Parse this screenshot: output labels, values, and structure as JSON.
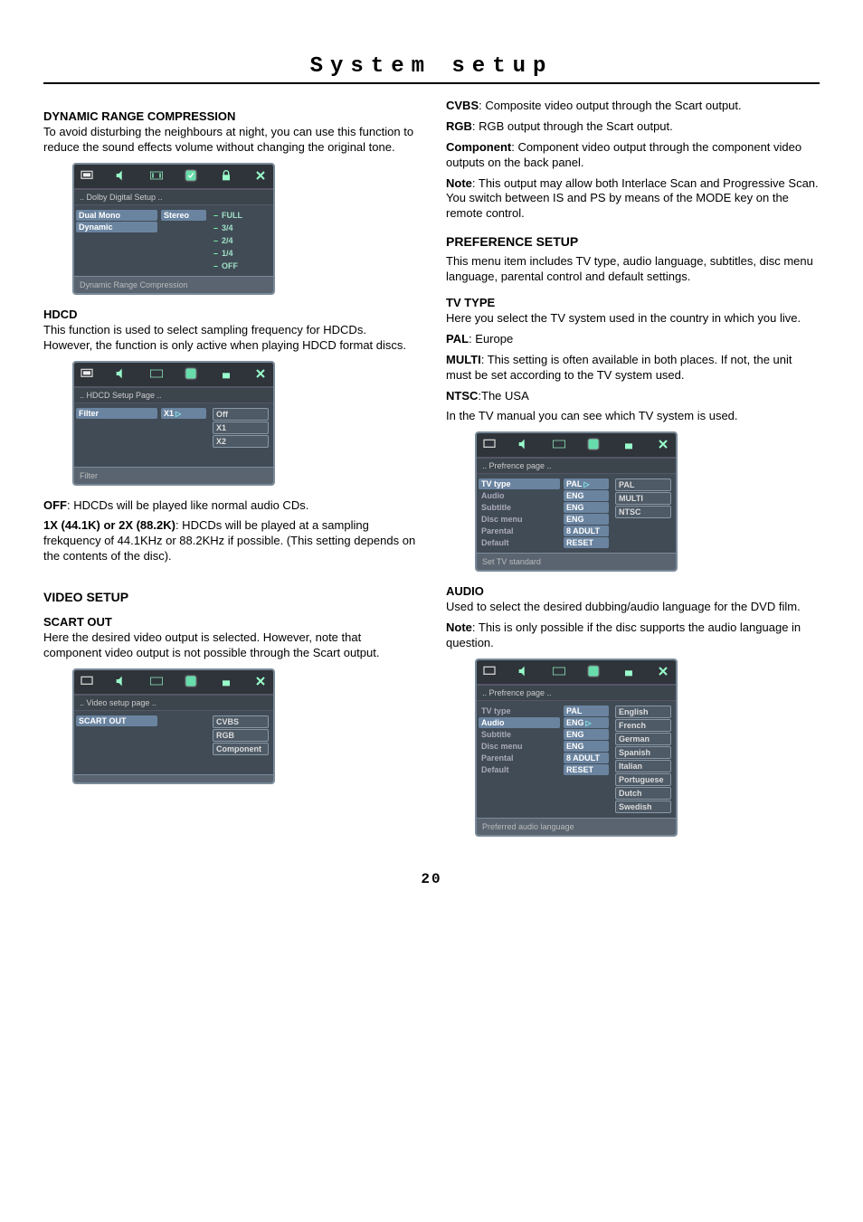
{
  "page_title": "System setup",
  "page_number": "20",
  "left": {
    "drc": {
      "heading": "DYNAMIC RANGE COMPRESSION",
      "body": "To avoid disturbing the neighbours at night, you can use this function to reduce the sound effects volume without changing the original tone.",
      "osd": {
        "title": ".. Dolby Digital  Setup  ..",
        "left_items": [
          "Dual Mono",
          "Dynamic"
        ],
        "mid_items": [
          "Stereo"
        ],
        "ladder": [
          "FULL",
          "3/4",
          "2/4",
          "1/4",
          "OFF"
        ],
        "footer": "Dynamic Range Compression"
      }
    },
    "hdcd": {
      "heading": "HDCD",
      "body": "This function is used to select sampling frequency for HDCDs. However, the function is only active when playing HDCD format discs.",
      "osd": {
        "title": ".. HDCD Setup Page ..",
        "left_items": [
          "Filter"
        ],
        "mid_items": [
          "X1"
        ],
        "right_items": [
          "Off",
          "X1",
          "X2"
        ],
        "footer": "Filter"
      },
      "off_label": "OFF",
      "off_text": ": HDCDs will be played like normal audio CDs.",
      "x_label": "1X (44.1K) or 2X (88.2K)",
      "x_text": ": HDCDs will be played at a sampling frekquency of 44.1KHz or 88.2KHz if possible. (This setting depends on the contents of the disc)."
    },
    "video": {
      "heading": "VIDEO SETUP",
      "scart_heading": "SCART OUT",
      "scart_body": "Here the desired video output is selected. However, note that component video output is not possible through the Scart output.",
      "osd": {
        "title": ".. Video setup  page  ..",
        "left_items": [
          "SCART OUT"
        ],
        "right_items": [
          "CVBS",
          "RGB",
          "Component"
        ],
        "footer": ""
      }
    }
  },
  "right": {
    "cvbs_label": "CVBS",
    "cvbs_text": ": Composite video output through the Scart output.",
    "rgb_label": "RGB",
    "rgb_text": ": RGB output through the Scart output.",
    "comp_label": "Component",
    "comp_text": ": Component video output through the component video outputs on the back panel.",
    "note_label": "Note",
    "note_text": ": This output may allow both Interlace Scan and Progressive Scan. You switch between IS and PS by means of the MODE key on the remote control.",
    "pref_heading": "PREFERENCE SETUP",
    "pref_body": "This menu item includes TV type, audio language, subtitles, disc menu language, parental control and default settings.",
    "tvtype": {
      "heading": "TV TYPE",
      "body": "Here you select the TV system used in the country in which you live.",
      "pal_label": "PAL",
      "pal_text": ": Europe",
      "multi_label": "MULTI",
      "multi_text": ": This setting is often available in both places. If not, the unit must be set according to the  TV system used.",
      "ntsc_label": "NTSC",
      "ntsc_text": ":The USA",
      "manual_text": "In the TV manual you can see which TV system is used.",
      "osd": {
        "title": ".. Prefrence  page  ..",
        "left_items": [
          "TV  type",
          "Audio",
          "Subtitle",
          "Disc  menu",
          "Parental",
          "Default"
        ],
        "mid_items": [
          "PAL",
          "ENG",
          "ENG",
          "ENG",
          "8 ADULT",
          "RESET"
        ],
        "right_items": [
          "PAL",
          "MULTI",
          "NTSC"
        ],
        "footer": "Set  TV  standard"
      }
    },
    "audio": {
      "heading": "AUDIO",
      "body": "Used to select the desired dubbing/audio language for the  DVD film.",
      "note_label": "Note",
      "note_text": ": This is only possible if the disc supports the audio language in question.",
      "osd": {
        "title": ".. Prefrence  page  ..",
        "left_items": [
          "TV  type",
          "Audio",
          "Subtitle",
          "Disc  menu",
          "Parental",
          "Default"
        ],
        "mid_items": [
          "PAL",
          "ENG",
          "ENG",
          "ENG",
          "8 ADULT",
          "RESET"
        ],
        "right_items": [
          "English",
          "French",
          "German",
          "Spanish",
          "Italian",
          "Portuguese",
          "Dutch",
          "Swedish"
        ],
        "footer": "Preferred audio language"
      }
    }
  }
}
